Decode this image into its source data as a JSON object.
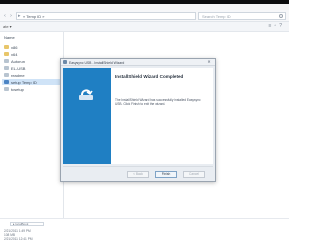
{
  "explorer": {
    "address_path": "« Temp ID »",
    "search_placeholder": "Search Temp ID",
    "toolbar_left": "ate ▾",
    "toolbar_right_icons": [
      "view-icon",
      "pane-icon",
      "help-icon"
    ],
    "nav_items": [
      {
        "label": "Name",
        "icon": "header"
      },
      {
        "label": "x86",
        "icon": "folder-icon"
      },
      {
        "label": "x64",
        "icon": "folder-icon"
      },
      {
        "label": "Autorun",
        "icon": "file-icon"
      },
      {
        "label": "EL-USB",
        "icon": "file-icon"
      },
      {
        "label": "readme",
        "icon": "file-icon"
      },
      {
        "label": "setup Temp ID",
        "icon": "setup-icon"
      },
      {
        "label": "tcsetup",
        "icon": "file-icon"
      }
    ],
    "bottom_scroll_label": "▸ localBook",
    "details_lines": [
      "2/21/2011 1:49 PM",
      "108 MB",
      "2/21/2011 12:41 PM"
    ]
  },
  "dialog": {
    "title": "Easysync USB - InstallShield Wizard",
    "close_label": "✕",
    "heading": "InstallShield Wizard Completed",
    "message": "The InstallShield Wizard has successfully installed Easysync USB. Click Finish to exit the wizard.",
    "buttons": {
      "back": "< Back",
      "finish": "Finish",
      "cancel": "Cancel"
    }
  },
  "colors": {
    "dialog_side": "#1f7fc3",
    "selection": "#cfe3f7"
  }
}
